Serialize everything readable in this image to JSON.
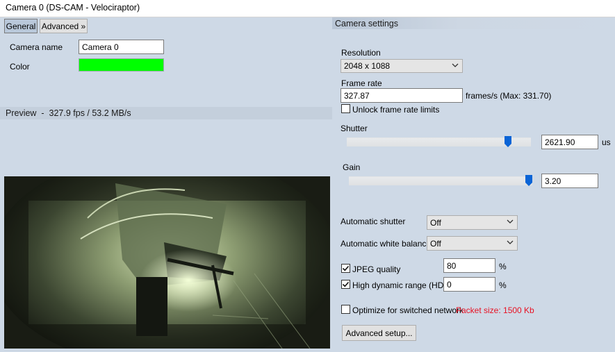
{
  "window": {
    "title": "Camera 0 (DS-CAM - Velociraptor)"
  },
  "tabs": {
    "general": "General",
    "advanced": "Advanced »"
  },
  "left": {
    "camera_name_label": "Camera name",
    "camera_name_value": "Camera 0",
    "color_label": "Color",
    "color_value": "#00ff00",
    "preview_header": "Preview  -  327.9 fps / 53.2 MB/s"
  },
  "settings": {
    "header": "Camera settings",
    "resolution_label": "Resolution",
    "resolution_value": "2048 x 1088",
    "frame_rate_label": "Frame rate",
    "frame_rate_value": "327.87",
    "frame_rate_unit": "frames/s (Max: 331.70)",
    "unlock_label": "Unlock frame rate limits",
    "unlock_checked": false,
    "shutter_label": "Shutter",
    "shutter_value": "2621.90",
    "shutter_unit": "us",
    "shutter_level": 0.89,
    "gain_label": "Gain",
    "gain_value": "3.20",
    "gain_level": 1.0,
    "auto_shutter_label": "Automatic shutter",
    "auto_shutter_value": "Off",
    "auto_wb_label": "Automatic white balance",
    "auto_wb_value": "Off",
    "jpeg_label": "JPEG quality",
    "jpeg_checked": true,
    "jpeg_value": "80",
    "jpeg_unit": "%",
    "hdr_label": "High dynamic range (HDR)",
    "hdr_checked": true,
    "hdr_value": "0",
    "hdr_unit": "%",
    "optimize_label": "Optimize for switched network",
    "optimize_checked": false,
    "packet_size_text": "Packet size: 1500 Kb",
    "advanced_setup_label": "Advanced setup..."
  },
  "colors": {
    "accent_thumb": "#0a64d6",
    "packet_text": "#e81123"
  }
}
